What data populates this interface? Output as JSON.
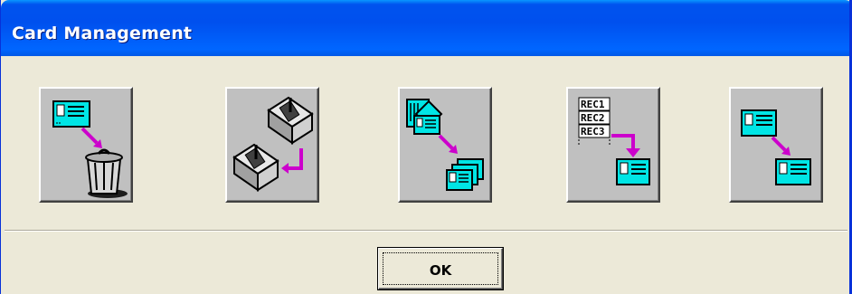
{
  "window": {
    "title": "Card Management"
  },
  "tools": [
    {
      "icon": "delete-card-icon"
    },
    {
      "icon": "copy-reader-icon"
    },
    {
      "icon": "batch-cards-icon"
    },
    {
      "icon": "records-to-card-icon"
    },
    {
      "icon": "card-to-card-icon"
    }
  ],
  "record_labels": [
    "REC1",
    "REC2",
    "REC3"
  ],
  "ok_button": {
    "label": "OK"
  },
  "colors": {
    "titlebar": "#0053ee",
    "dialog_bg": "#ece9d8",
    "button_face": "#c0c0c0",
    "card_cyan": "#00e5e5",
    "arrow_magenta": "#cc00cc"
  }
}
